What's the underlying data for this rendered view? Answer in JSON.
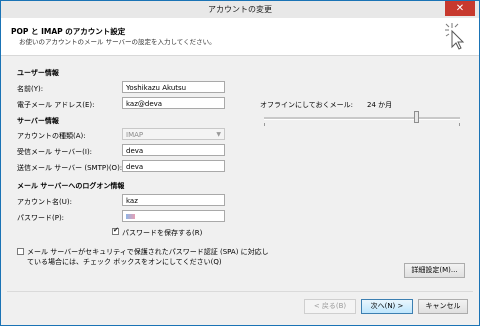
{
  "window": {
    "title": "アカウントの変更",
    "close_glyph": "✕"
  },
  "header": {
    "title": "POP と IMAP のアカウント設定",
    "subtitle": "お使いのアカウントのメール サーバーの設定を入力してください。"
  },
  "user_info": {
    "heading": "ユーザー情報",
    "name_label": "名前(Y):",
    "name_value": "Yoshikazu Akutsu",
    "email_label": "電子メール アドレス(E):",
    "email_value": "kaz@deva"
  },
  "server_info": {
    "heading": "サーバー情報",
    "account_type_label": "アカウントの種類(A):",
    "account_type_value": "IMAP",
    "incoming_label": "受信メール サーバー(I):",
    "incoming_value": "deva",
    "outgoing_label": "送信メール サーバー (SMTP)(O):",
    "outgoing_value": "deva"
  },
  "logon_info": {
    "heading": "メール サーバーへのログオン情報",
    "account_label": "アカウント名(U):",
    "account_value": "kaz",
    "password_label": "パスワード(P):",
    "save_password_label": "パスワードを保存する(R)",
    "save_password_checked": true,
    "spa_label_line1": "メール サーバーがセキュリティで保護されたパスワード認証 (SPA) に対応し",
    "spa_label_line2": "ている場合には、チェック ボックスをオンにしてください(Q)",
    "spa_checked": false
  },
  "offline": {
    "label": "オフラインにしておくメール:",
    "value": "24 か月",
    "slider_fraction": 0.78
  },
  "buttons": {
    "more_settings": "詳細設定(M)...",
    "back": "< 戻る(B)",
    "next": "次へ(N) >",
    "cancel": "キャンセル"
  }
}
